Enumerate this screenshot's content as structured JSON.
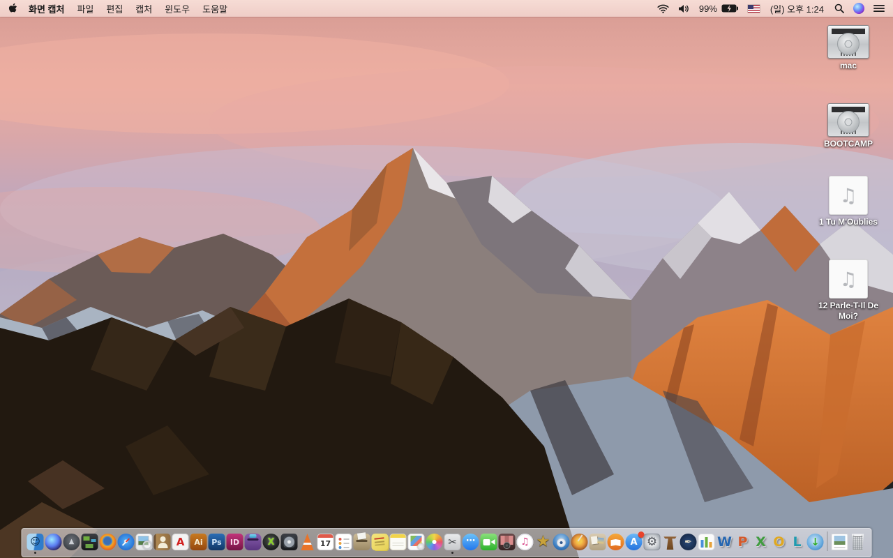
{
  "menu_bar": {
    "apple_logo": "apple-icon",
    "app_name": "화면 캡처",
    "menus": [
      "파일",
      "편집",
      "캡처",
      "윈도우",
      "도움말"
    ],
    "status": {
      "icons": [
        "wifi-icon",
        "volume-icon",
        "battery-charging-icon",
        "input-source-us-flag",
        "spotlight-search-icon",
        "siri-icon",
        "notification-center-icon"
      ],
      "battery_percent": "99%",
      "clock": "(일) 오후 1:24"
    }
  },
  "desktop": {
    "icons": [
      {
        "name": "drive-mac",
        "type": "drive",
        "label": "mac"
      },
      {
        "name": "drive-bootcamp",
        "type": "drive",
        "label": "BOOTCAMP"
      },
      {
        "name": "audio-1-tu-moublies",
        "type": "audio",
        "label": "1 Tu M'Oublies"
      },
      {
        "name": "audio-12-parle-t-il-de-moi",
        "type": "audio",
        "label": "12 Parle-T-Il De Moi?"
      }
    ]
  },
  "dock": {
    "items": [
      {
        "name": "finder",
        "glyph": "☺",
        "running": true
      },
      {
        "name": "siri",
        "glyph": ""
      },
      {
        "name": "launchpad",
        "glyph": "▲"
      },
      {
        "name": "mission-control",
        "glyph": ""
      },
      {
        "name": "firefox",
        "glyph": ""
      },
      {
        "name": "safari",
        "glyph": ""
      },
      {
        "name": "preview",
        "glyph": ""
      },
      {
        "name": "contacts",
        "glyph": ""
      },
      {
        "name": "acrobat",
        "glyph": "A"
      },
      {
        "name": "illustrator",
        "glyph": "Ai"
      },
      {
        "name": "photoshop",
        "glyph": "Ps"
      },
      {
        "name": "indesign",
        "glyph": "ID"
      },
      {
        "name": "toast",
        "glyph": ""
      },
      {
        "name": "green-x",
        "glyph": "X"
      },
      {
        "name": "disk-tool",
        "glyph": ""
      },
      {
        "name": "vlc",
        "glyph": ""
      },
      {
        "name": "calendar",
        "glyph": "17"
      },
      {
        "name": "reminders",
        "glyph": ""
      },
      {
        "name": "archive-box",
        "glyph": ""
      },
      {
        "name": "stickies",
        "glyph": ""
      },
      {
        "name": "notes",
        "glyph": ""
      },
      {
        "name": "doc-viewer",
        "glyph": ""
      },
      {
        "name": "photos",
        "glyph": ""
      },
      {
        "name": "grab",
        "glyph": "✂",
        "running": true
      },
      {
        "name": "messages",
        "glyph": "⋯"
      },
      {
        "name": "facetime",
        "glyph": ""
      },
      {
        "name": "photo-booth",
        "glyph": ""
      },
      {
        "name": "itunes",
        "glyph": "♫"
      },
      {
        "name": "imovie",
        "glyph": "★"
      },
      {
        "name": "dvd-player",
        "glyph": ""
      },
      {
        "name": "garageband",
        "glyph": ""
      },
      {
        "name": "pinboard",
        "glyph": ""
      },
      {
        "name": "ibooks",
        "glyph": ""
      },
      {
        "name": "app-store",
        "glyph": "A",
        "badge": true
      },
      {
        "name": "system-preferences",
        "glyph": "⚙"
      },
      {
        "name": "keynote",
        "glyph": ""
      },
      {
        "name": "pages",
        "glyph": "✒"
      },
      {
        "name": "numbers",
        "glyph": ""
      },
      {
        "name": "word",
        "glyph": "W"
      },
      {
        "name": "powerpoint",
        "glyph": "P"
      },
      {
        "name": "excel",
        "glyph": "X"
      },
      {
        "name": "outlook",
        "glyph": "O"
      },
      {
        "name": "lync",
        "glyph": "L"
      },
      {
        "name": "downloader",
        "glyph": "↓"
      },
      {
        "name": "separator",
        "type": "separator"
      },
      {
        "name": "document-file",
        "glyph": ""
      },
      {
        "name": "trash",
        "glyph": ""
      }
    ]
  },
  "colors": {
    "menubar_bg": "#f5ded7",
    "dock_bg": "rgba(235,233,238,0.6)",
    "badge_red": "#e8432a",
    "sky_pink": "#e9aca1",
    "sky_lavender": "#b3abc4",
    "sunlit_rock": "#c4703c",
    "foreground_rock": "#221910"
  }
}
